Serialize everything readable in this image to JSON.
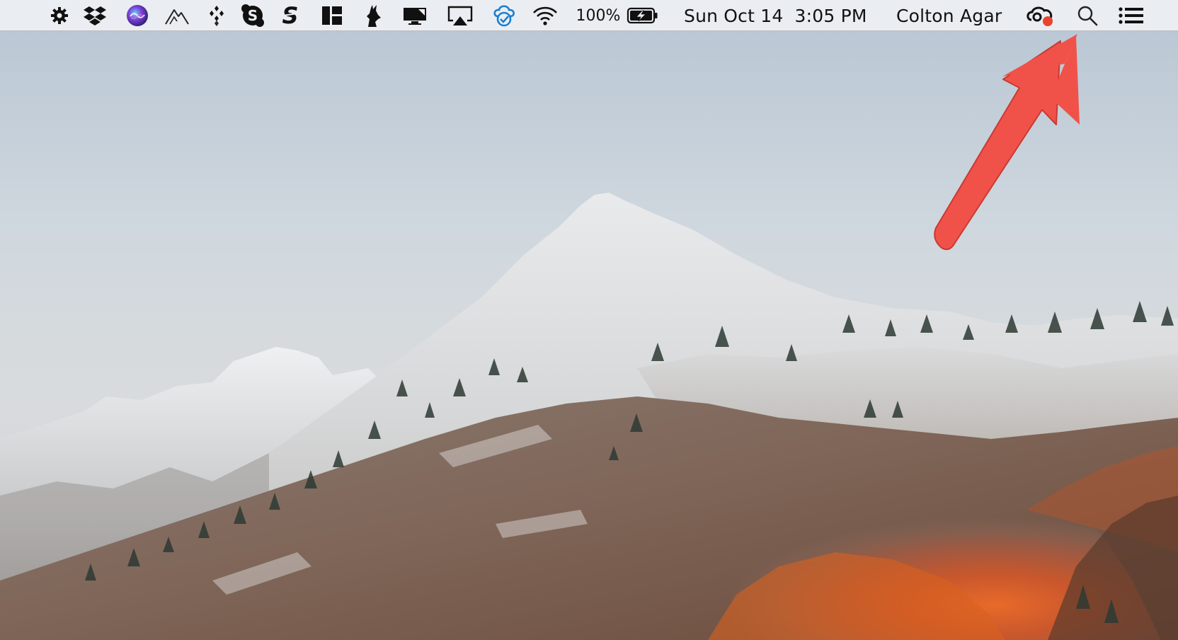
{
  "menubar": {
    "battery_percent": "100%",
    "clock_day": "Sun Oct 14",
    "clock_time": "3:05 PM",
    "user_name": "Colton Agar",
    "status_items": [
      "gear-icon",
      "dropbox-icon",
      "siri-icon",
      "mountain-icon",
      "diamond-dots-icon",
      "skype-icon",
      "scrivener-s-icon",
      "layout-icon",
      "rabbit-icon",
      "display-icon",
      "airplay-icon",
      "sync-check-icon",
      "wifi-icon",
      "battery-charging-icon",
      "creative-cloud-icon",
      "spotlight-search-icon",
      "notification-center-icon"
    ]
  },
  "annotation": {
    "arrow_color": "#f0524a",
    "points_to": "spotlight-search-icon"
  },
  "colors": {
    "menubar_bg": "#eceef1",
    "notification_dot": "#e8452c",
    "siri_gradient": [
      "#3b2fd6",
      "#d2318f"
    ],
    "sync_blue": "#1a7fd1"
  }
}
